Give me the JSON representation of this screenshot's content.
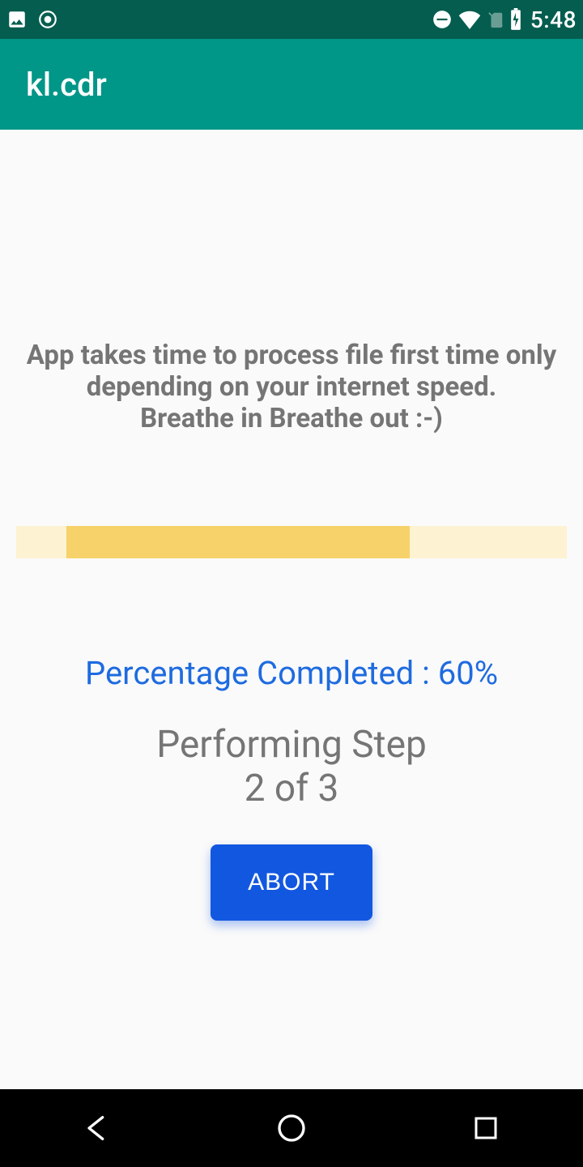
{
  "status_bar": {
    "time": "5:48"
  },
  "app_bar": {
    "title": "kl.cdr"
  },
  "content": {
    "info_line1": "App takes time to process file first time only",
    "info_line2": "depending on your internet speed.",
    "info_line3": "Breathe in Breathe out :-)",
    "percentage_label": "Percentage Completed : 60%",
    "percentage_value": 60,
    "step_line1": "Performing Step",
    "step_line2": "2 of 3",
    "step_current": 2,
    "step_total": 3,
    "abort_label": "ABORT"
  },
  "colors": {
    "status_bg": "#045d4e",
    "appbar_bg": "#009688",
    "accent_blue": "#1257e0",
    "progress_track": "#fdf2d2",
    "progress_fill": "#f7d26a"
  }
}
